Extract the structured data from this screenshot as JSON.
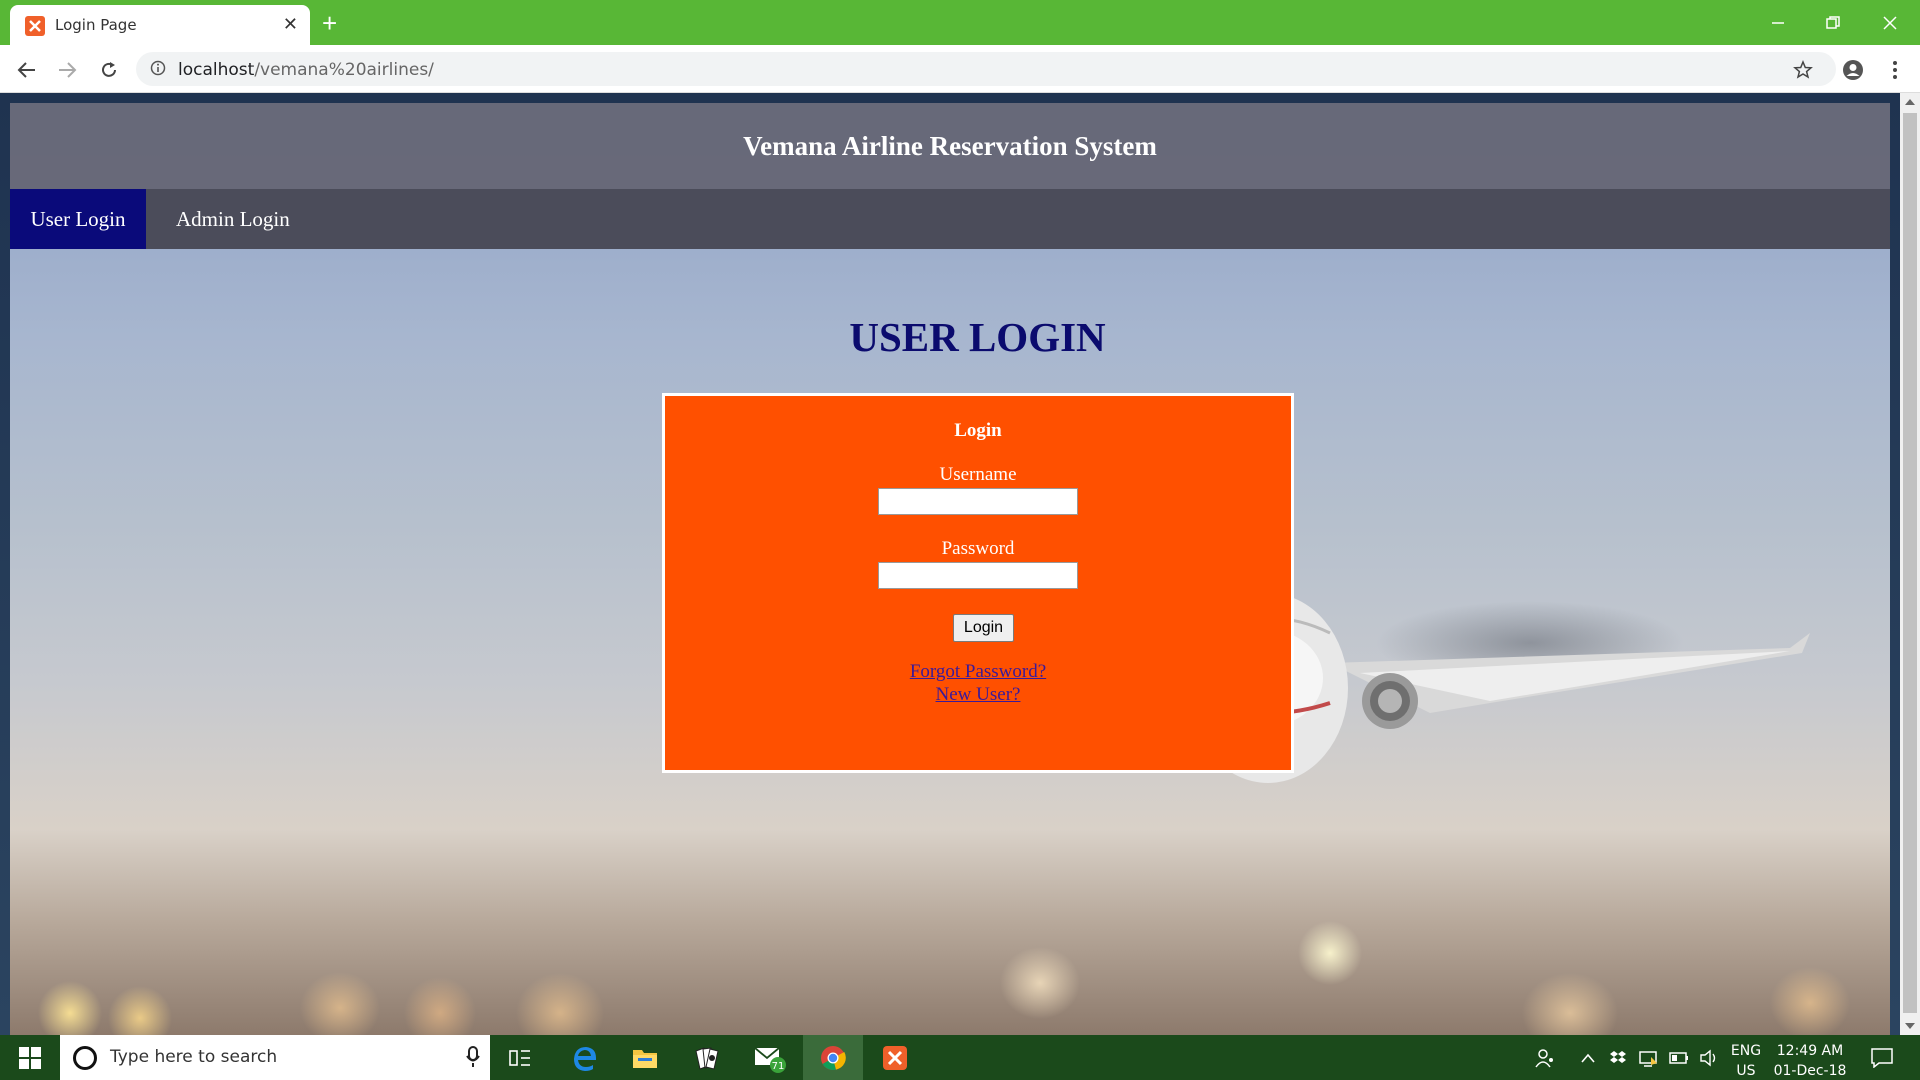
{
  "browser": {
    "tab_title": "Login Page",
    "tab_close": "✕",
    "new_tab": "+",
    "url_host": "localhost",
    "url_path": "/vemana%20airlines/"
  },
  "site": {
    "title": "Vemana Airline Reservation System",
    "nav": {
      "user_login": "User Login",
      "admin_login": "Admin Login"
    },
    "heading": "USER LOGIN"
  },
  "login_form": {
    "title": "Login",
    "username_label": "Username",
    "username_value": "",
    "password_label": "Password",
    "password_value": "",
    "login_button": "Login",
    "forgot_link": "Forgot Password?",
    "new_user_link": "New User?"
  },
  "taskbar": {
    "search_placeholder": "Type here to search",
    "mail_badge": "71",
    "lang_line1": "ENG",
    "lang_line2": "US",
    "time": "12:49 AM",
    "date": "01-Dec-18"
  },
  "colors": {
    "tab_bar": "#58b736",
    "site_header": "#646473",
    "site_nav": "#484855",
    "active_nav": "#0a0a7a",
    "heading": "#0b0b6e",
    "login_box": "#ff5000",
    "link": "#3a1a9a",
    "taskbar": "#1b4a1b"
  }
}
